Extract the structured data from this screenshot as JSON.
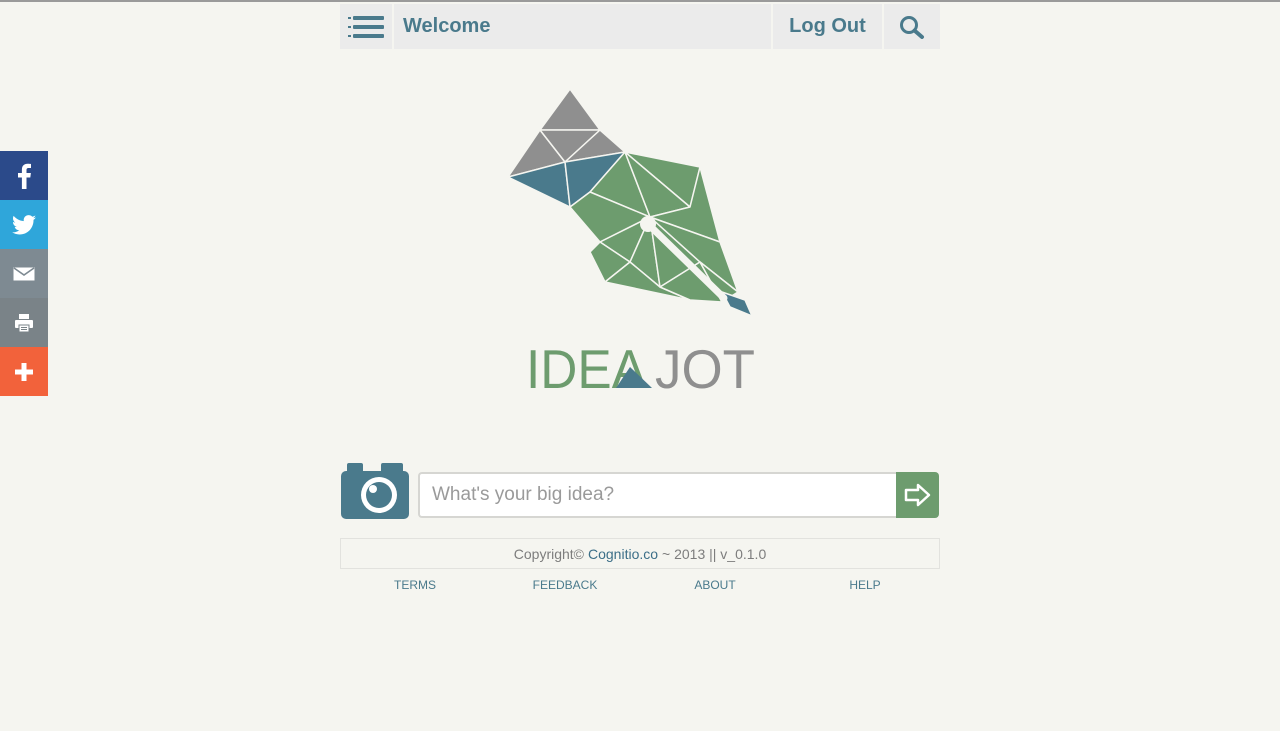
{
  "nav": {
    "title": "Welcome",
    "logout_label": "Log Out"
  },
  "social": [
    "facebook-icon",
    "twitter-icon",
    "mail-icon",
    "print-icon",
    "plus-icon"
  ],
  "logo": {
    "word_left": "IDEA",
    "word_right": "JOT"
  },
  "idea_input": {
    "placeholder": "What's your big idea?",
    "value": ""
  },
  "footer": {
    "copyright_prefix": "Copyright©",
    "company_link": "Cognitio.co",
    "copyright_suffix": "~ 2013 || v_0.1.0",
    "links": [
      "TERMS",
      "FEEDBACK",
      "ABOUT",
      "HELP"
    ]
  },
  "colors": {
    "accent_blue": "#4a7a8c",
    "accent_green": "#6d9c6e",
    "background": "#f5f5f0",
    "nav_bg": "#ebebeb"
  }
}
